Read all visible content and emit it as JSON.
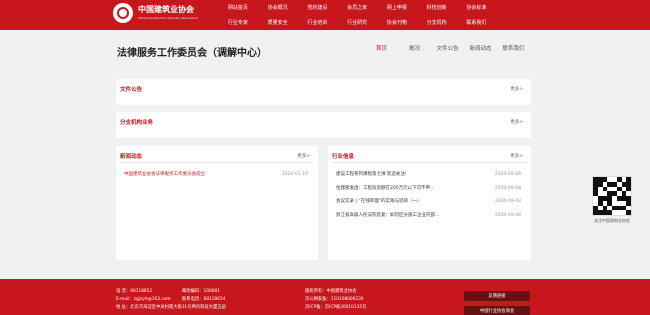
{
  "header": {
    "logo_cn": "中国建筑业协会",
    "logo_en": "China Construction Industry Association",
    "nav_row1": [
      "网站首页",
      "协会概况",
      "党的建设",
      "会员之家",
      "网上申报",
      "科技创新",
      "协会标准"
    ],
    "nav_row2": [
      "行业专家",
      "质量安全",
      "行业培训",
      "行业研究",
      "协会刊物",
      "分支机构",
      "联系我们"
    ]
  },
  "page": {
    "title": "法律服务工作委员会（调解中心）",
    "subnav": [
      "首页",
      "概况",
      "文件公告",
      "新闻动态",
      "联系我们"
    ]
  },
  "panels": {
    "wenjian": {
      "title": "文件公告",
      "more": "更多>"
    },
    "fenzhi": {
      "title": "分支机构业务",
      "more": "更多>"
    },
    "news": {
      "title": "新闻动态",
      "more": "更多>",
      "items": [
        {
          "text": "中国建筑业协会法律服务工作委员会成立",
          "date": "2020-01-10"
        }
      ]
    },
    "industry": {
      "title": "行业信息",
      "more": "更多>",
      "items": [
        {
          "text": "建设工程系列课程第七讲 欢迎关注!",
          "date": "2020-09-08"
        },
        {
          "text": "住建部发函：工程投资额在200万元以下可不申...",
          "date": "2020-09-08"
        },
        {
          "text": "会议实录 | “在线审理”的实践与思辨（一）",
          "date": "2020-09-08"
        },
        {
          "text": "浙江省高级人民法院答复：如何区分施工企业内部...",
          "date": "2020-09-08"
        }
      ]
    }
  },
  "qr": {
    "caption": "关注中国建筑业协会"
  },
  "footer": {
    "col1": [
      "电 话：66118852",
      "E-mail：zgjzyh@163.com",
      "地 址：北京市海淀区中关村南大街31号神舟科技大厦五层"
    ],
    "col2": [
      "邮政编码：100081",
      "联系电话：68118654"
    ],
    "col3": [
      "版权所有：中国建筑业协会",
      "京公网安备：110108006230",
      "京ICP备：京ICP备20010135号"
    ],
    "btn1": "友情链接",
    "btn2": "中国行业协会商会"
  }
}
